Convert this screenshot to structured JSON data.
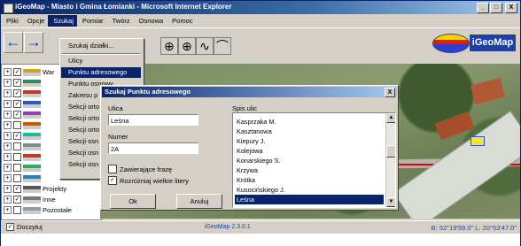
{
  "window": {
    "title": "iGeoMap - Miasto i Gmina Łomianki - Microsoft Internet Explorer",
    "buttons": {
      "minimize": "_",
      "maximize": "□",
      "close": "X"
    }
  },
  "menubar": [
    "Pliki",
    "Opcje",
    "Szukaj",
    "Pomiar",
    "Twórz",
    "Osnowa",
    "Pomoc"
  ],
  "toolbar": {
    "back_icon": "←",
    "forward_icon": "→",
    "tool_icons": [
      "⊕",
      "⊕",
      "∿",
      "⌒"
    ]
  },
  "logo": {
    "text": "iGeoMap"
  },
  "dropdown_menu": {
    "items": [
      "Szukaj działki...",
      "Ulicy",
      "Punktu adresowego",
      "Punktu osnowy",
      "Zakresu p",
      "Sekcji orto",
      "Sekcji orto",
      "Sekcji orto",
      "Sekcji osn",
      "Sekcji osn",
      "Sekcji osn"
    ],
    "highlighted_index": 2
  },
  "layer_tree": {
    "rows": [
      {
        "label": "War",
        "checked": true
      },
      {
        "label": "",
        "checked": true
      },
      {
        "label": "",
        "checked": true
      },
      {
        "label": "",
        "checked": true
      },
      {
        "label": "",
        "checked": true
      },
      {
        "label": "",
        "checked": false
      },
      {
        "label": "",
        "checked": true
      },
      {
        "label": "",
        "checked": false
      },
      {
        "label": "",
        "checked": false
      },
      {
        "label": "",
        "checked": false
      },
      {
        "label": "",
        "checked": false
      },
      {
        "label": "Projekty",
        "checked": true
      },
      {
        "label": "Inne",
        "checked": true
      },
      {
        "label": "Pozostałe",
        "checked": false
      }
    ]
  },
  "dialog": {
    "title": "Szukaj Punktu adresowego",
    "close": "X",
    "street_label": "Ulica",
    "street_value": "Leśna",
    "number_label": "Numer",
    "number_value": "2A",
    "contains_phrase_label": "Zawierające frazę",
    "contains_phrase_checked": false,
    "case_sensitive_label": "Rozróżniaj wielkie litery",
    "case_sensitive_checked": true,
    "ok_label": "Ok",
    "cancel_label": "Anuluj",
    "street_list_label": "Spis ulic",
    "street_list": [
      "Kasprzaka M.",
      "Kasztanowa",
      "Kiepury J.",
      "Kolejowa",
      "Konarskiego S.",
      "Krzywa",
      "Krótka",
      "Kusocińskiego J.",
      "Leśna"
    ],
    "selected_street": "Leśna"
  },
  "status_bar": {
    "checkbox_label": "Doczytuj",
    "checkbox_checked": true,
    "version": "iGeoMap 2.3.0.1",
    "coordinates": "B: 52°19'59.0\" L: 20°53'47.0\""
  },
  "colors": {
    "title_blue": "#0a246a",
    "selection_blue": "#0a246a",
    "map_red_line": "#e0001b",
    "link_blue": "#1b3fb0"
  }
}
